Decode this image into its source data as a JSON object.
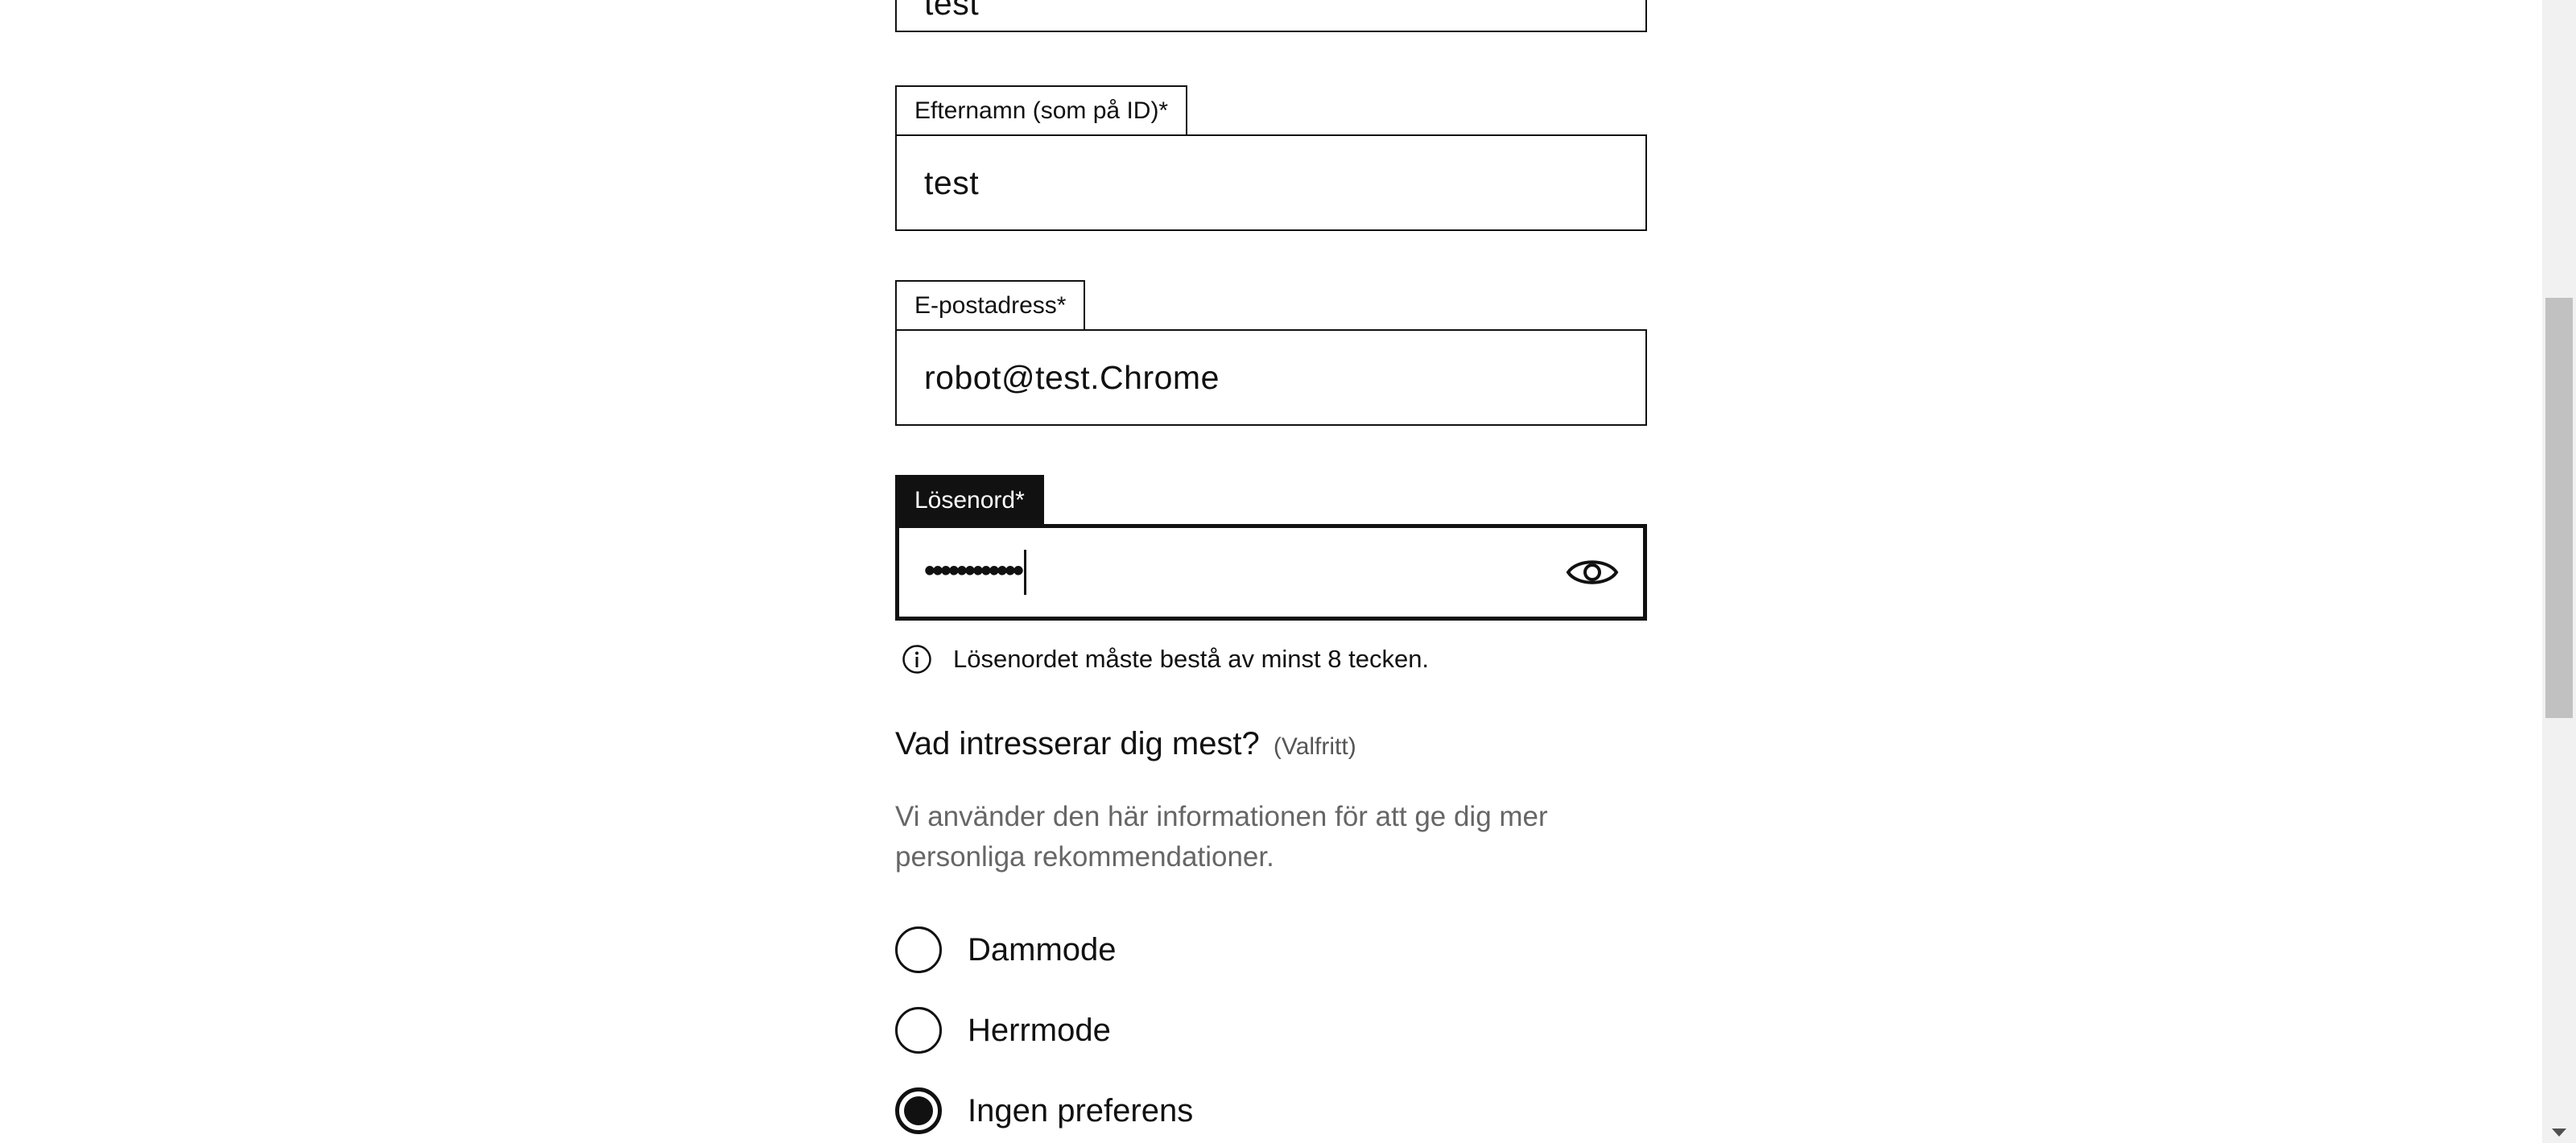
{
  "form": {
    "first_name": {
      "value": "test"
    },
    "last_name": {
      "label": "Efternamn (som på ID)*",
      "value": "test"
    },
    "email": {
      "label": "E-postadress*",
      "value": "robot@test.Chrome"
    },
    "password": {
      "label": "Lösenord*",
      "masked_value": "••••••••••••",
      "toggle_icon": "eye-icon",
      "hint_icon": "info-icon",
      "hint": "Lösenordet måste bestå av minst 8 tecken."
    }
  },
  "interests": {
    "title": "Vad intresserar dig mest?",
    "optional": "(Valfritt)",
    "description": "Vi använder den här informationen för att ge dig mer personliga rekommendationer.",
    "options": [
      {
        "label": "Dammode",
        "checked": false
      },
      {
        "label": "Herrmode",
        "checked": false
      },
      {
        "label": "Ingen preferens",
        "checked": true
      }
    ]
  },
  "colors": {
    "text": "#111111",
    "muted": "#666666",
    "background": "#ffffff",
    "scrollbar_track": "#f1f1f1",
    "scrollbar_thumb": "#c1c1c1"
  }
}
